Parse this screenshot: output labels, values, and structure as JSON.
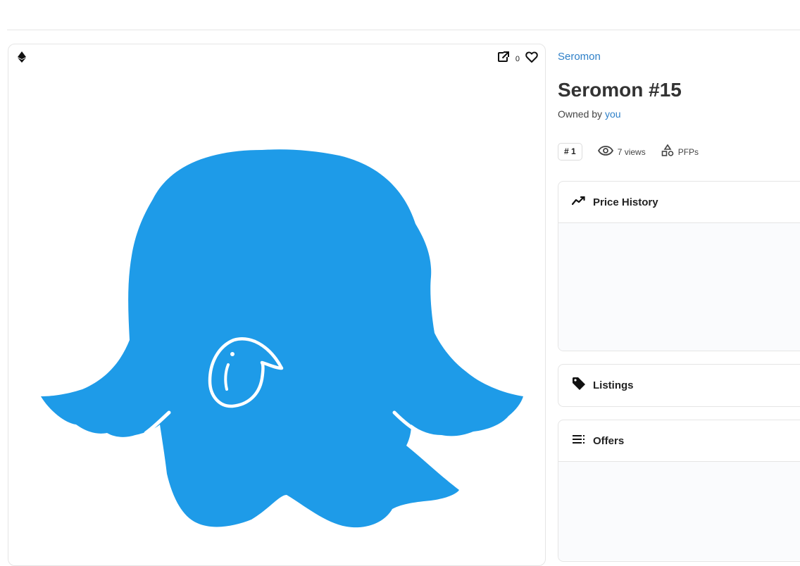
{
  "item": {
    "collection": "Seromon",
    "title": "Seromon #15",
    "owned_by_prefix": "Owned by",
    "owner": "you"
  },
  "media": {
    "like_count": "0",
    "art_color": "#1e9be8",
    "icons": [
      "ethereum-icon",
      "external-link-icon",
      "heart-icon"
    ]
  },
  "stats": {
    "rank": "# 1",
    "views": "7 views",
    "category": "PFPs"
  },
  "panels": {
    "price_history": "Price History",
    "listings": "Listings",
    "offers": "Offers"
  },
  "colors": {
    "link": "#2f80c8",
    "border": "#e5e5e5",
    "panel_bg": "#fafbfd"
  }
}
